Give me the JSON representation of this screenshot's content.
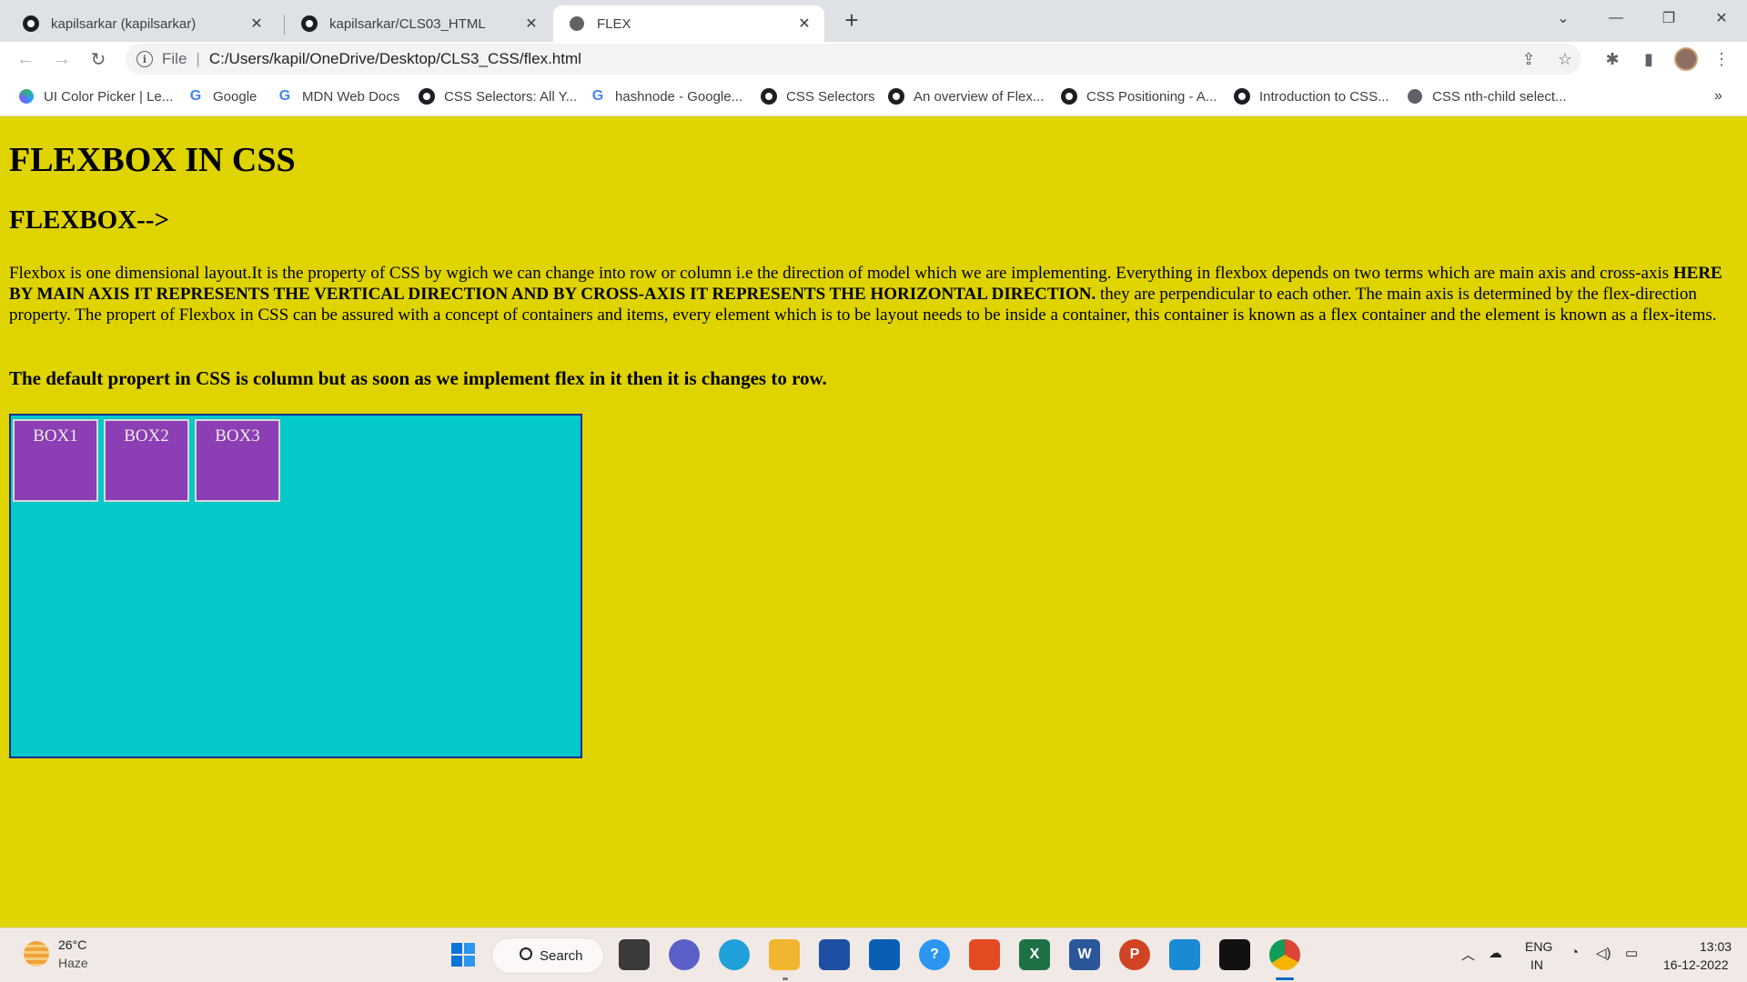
{
  "tabs": [
    {
      "title": "kapilsarkar (kapilsarkar)",
      "icon": "github-icon"
    },
    {
      "title": "kapilsarkar/CLS03_HTML",
      "icon": "github-icon"
    },
    {
      "title": "FLEX",
      "icon": "globe-icon"
    }
  ],
  "omnibox": {
    "scheme": "File",
    "url": "C:/Users/kapil/OneDrive/Desktop/CLS3_CSS/flex.html"
  },
  "bookmarks": [
    {
      "label": "UI Color Picker | Le...",
      "icon": "uicolorpicker-icon"
    },
    {
      "label": "Google",
      "icon": "google-icon"
    },
    {
      "label": "MDN Web Docs",
      "icon": "google-icon"
    },
    {
      "label": "CSS Selectors: All Y...",
      "icon": "github-icon"
    },
    {
      "label": "hashnode - Google...",
      "icon": "google-icon"
    },
    {
      "label": "CSS Selectors",
      "icon": "github-icon"
    },
    {
      "label": "An overview of Flex...",
      "icon": "github-icon"
    },
    {
      "label": "CSS Positioning - A...",
      "icon": "github-icon"
    },
    {
      "label": "Introduction to CSS...",
      "icon": "github-icon"
    },
    {
      "label": "CSS nth-child select...",
      "icon": "globe-icon"
    }
  ],
  "page": {
    "heading": "FLEXBOX IN CSS",
    "subheading": "FLEXBOX-->",
    "para_intro": "Flexbox is one dimensional layout.It is the property of CSS by wgich we can change into row or column i.e the direction of model which we are implementing. Everything in flexbox depends on two terms which are main axis and cross-axis ",
    "para_bold": "HERE BY MAIN AXIS IT REPRESENTS THE VERTICAL DIRECTION AND BY CROSS-AXIS IT REPRESENTS THE HORIZONTAL DIRECTION.",
    "para_rest": " they are perpendicular to each other. The main axis is determined by the flex-direction property. The propert of Flexbox in CSS can be assured with a concept of containers and items, every element which is to be layout needs to be inside a container, this container is known as a flex container and the element is known as a flex-items.",
    "note": "The default propert in CSS is column but as soon as we implement flex in it then it is changes to row.",
    "boxes": [
      "BOX1",
      "BOX2",
      "BOX3"
    ]
  },
  "taskbar": {
    "temperature": "26°C",
    "condition": "Haze",
    "search_label": "Search",
    "lang_primary": "ENG",
    "lang_secondary": "IN",
    "time": "13:03",
    "date": "16-12-2022"
  },
  "colors": {
    "page_background": "#dfd300",
    "flex_container": "#05c8c8",
    "flex_item": "#8c3eb4"
  }
}
